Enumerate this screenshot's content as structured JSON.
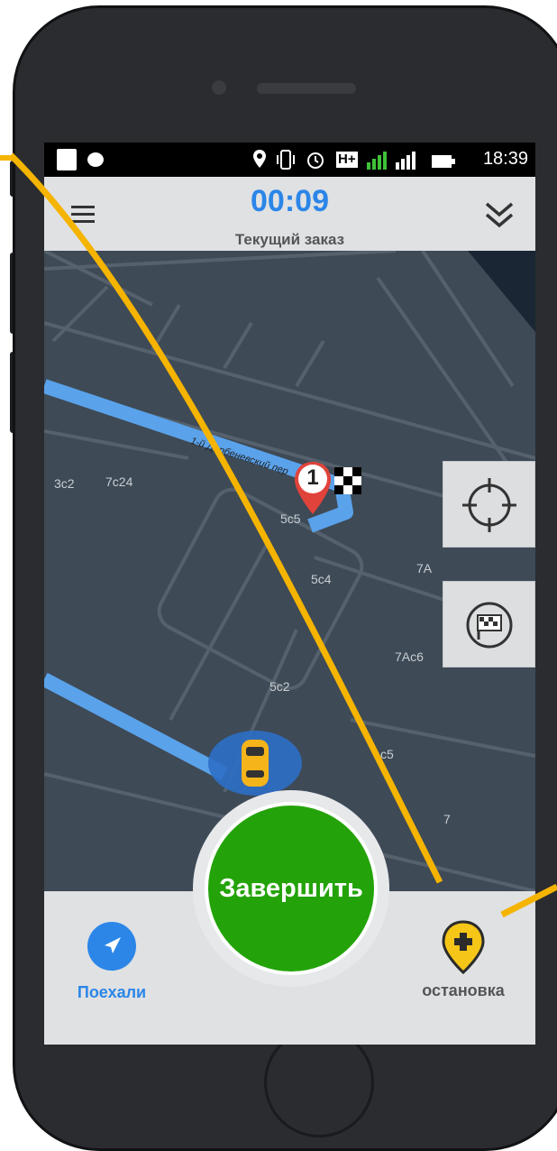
{
  "status_bar": {
    "time": "18:39",
    "network_type": "H+",
    "sim_slot": "2"
  },
  "header": {
    "timer": "00:09",
    "subtitle": "Текущий заказ",
    "menu_icon": "hamburger-menu-icon",
    "collapse_icon": "double-chevron-down-icon"
  },
  "map": {
    "street_name": "1-й Дербеневский пер",
    "waypoint_number": "1",
    "building_labels": [
      "3с2",
      "7с24",
      "5с5",
      "5с4",
      "7А",
      "7Ас6",
      "5с2",
      "с5",
      "7"
    ]
  },
  "map_controls": {
    "locate_icon": "crosshair-icon",
    "finish_route_icon": "checkered-flag-icon"
  },
  "actions": {
    "finish_label": "Завершить",
    "go_label": "Поехали",
    "stop_label": "остановка"
  },
  "colors": {
    "accent_blue": "#2b86e8",
    "finish_green": "#23a309",
    "stop_yellow": "#f5c518",
    "map_bg": "#3e4a56",
    "route_blue": "#5aa2ea"
  }
}
